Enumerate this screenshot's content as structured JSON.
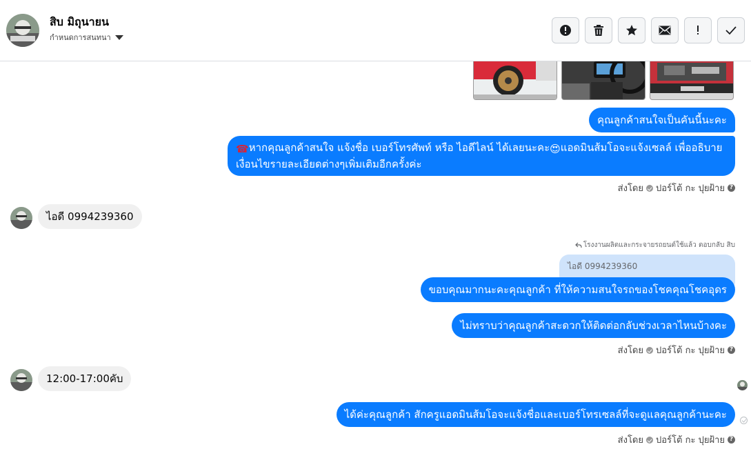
{
  "header": {
    "contact_name": "สิบ มิถุนายน",
    "subtitle": "กำหนดการสนทนา",
    "tools": [
      {
        "icon": "alert-circle-icon",
        "label": "report"
      },
      {
        "icon": "trash-icon",
        "label": "delete"
      },
      {
        "icon": "star-icon",
        "label": "star"
      },
      {
        "icon": "envelope-icon",
        "label": "mark-unread"
      },
      {
        "icon": "exclamation-icon",
        "label": "follow-up"
      },
      {
        "icon": "check-icon",
        "label": "done"
      }
    ]
  },
  "messages": {
    "out1": "คุณลูกค้าสนใจเป็นคันนี้นะคะ",
    "out2_emoji1": "☎",
    "out2_text_a": "หากคุณลูกค้าสนใจ แจ้งชื่อ เบอร์โทรศัพท์ หรือ ไอดีไลน์  ได้เลยนะคะ",
    "out2_emoji2": "😍",
    "out2_text_b": "แอดมินส้มโอจะแจ้งเซลล์   เพื่ออธิบายเงื่อนไขรายละเอียดต่างๆเพิ่มเติมอีกครั้งค่ะ",
    "meta1": "ส่งโดย",
    "meta1_by": "ปอร์โต้ กะ ปุยฝ้าย",
    "in1": "ไอดี 0994239360",
    "reply_label": "โรงงานผลิตและกระจายรถยนต์ใช้แล้ว ตอบกลับ สิบ",
    "quoted": "ไอดี 0994239360",
    "out3": "ขอบคุณมากนะคะคุณลูกค้า ที่ให้ความสนใจรถของโชคคุณโชคอุดร",
    "out4": "ไม่ทราบว่าคุณลูกค้าสะดวกให้ติดต่อกลับช่วงเวลาไหนบ้างคะ",
    "meta2": "ส่งโดย",
    "meta2_by": "ปอร์โต้ กะ ปุยฝ้าย",
    "in2": "12:00-17:00คับ",
    "out5": "ได้ค่ะคุณลูกค้า สักครูแอดมินส้มโอจะแจ้งชื่อและเบอร์โทรเซลล์ที่จะดูแลคุณลูกค้านะคะ",
    "meta3": "ส่งโดย",
    "meta3_by": "ปอร์โต้ กะ ปุยฝ้าย",
    "help_glyph": "?"
  },
  "colors": {
    "outgoing_bubble": "#0a7cff",
    "incoming_bubble": "#f0f0f0",
    "quote_bubble": "#cfe3fb"
  }
}
